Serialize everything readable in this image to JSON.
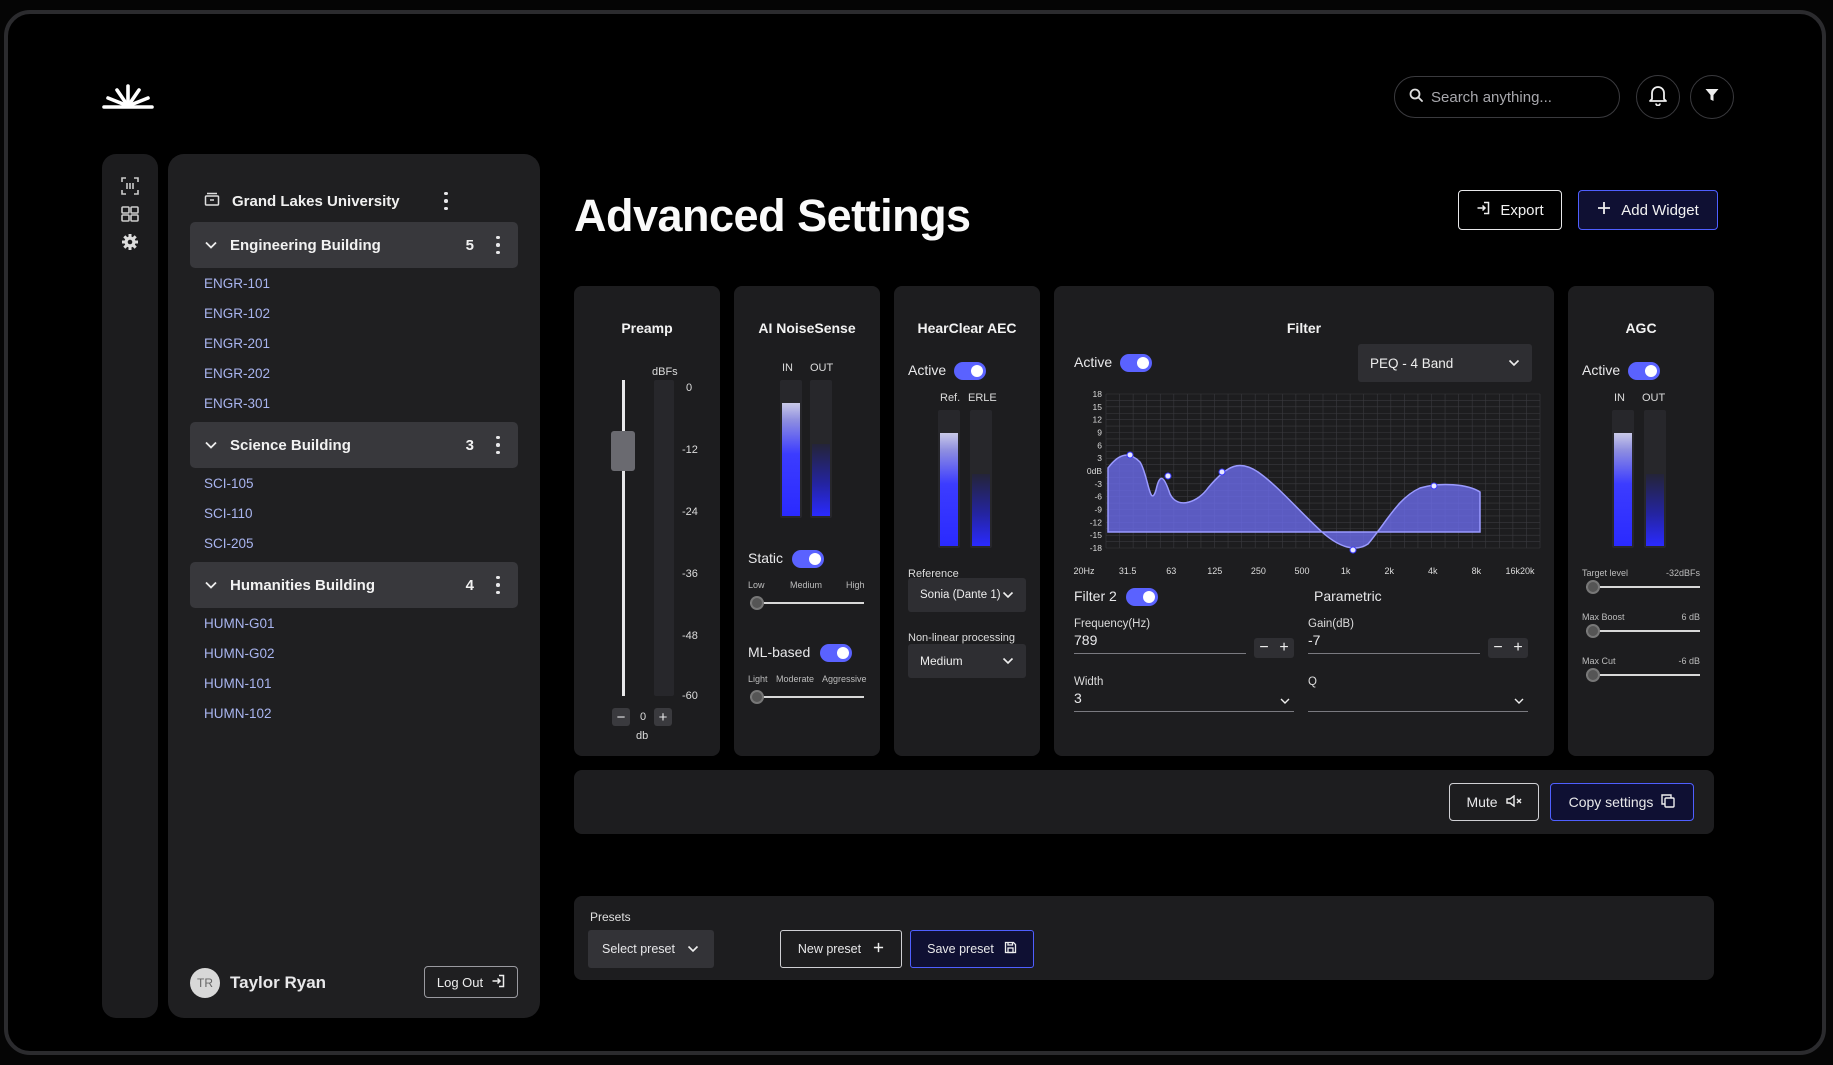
{
  "header": {
    "search_placeholder": "Search anything...",
    "icons": [
      "logo-icon",
      "search-icon",
      "bell-icon",
      "filter-icon"
    ]
  },
  "rail": {
    "icons": [
      "scan-icon",
      "grid-icon",
      "gear-icon"
    ]
  },
  "sidebar": {
    "org": "Grand Lakes University",
    "groups": [
      {
        "label": "Engineering Building",
        "count": "5",
        "rooms": [
          "ENGR-101",
          "ENGR-102",
          "ENGR-201",
          "ENGR-202",
          "ENGR-301"
        ]
      },
      {
        "label": "Science Building",
        "count": "3",
        "rooms": [
          "SCI-105",
          "SCI-110",
          "SCI-205"
        ]
      },
      {
        "label": "Humanities Building",
        "count": "4",
        "rooms": [
          "HUMN-G01",
          "HUMN-G02",
          "HUMN-101",
          "HUMN-102"
        ]
      }
    ],
    "user": {
      "initials": "TR",
      "name": "Taylor Ryan"
    },
    "logout": "Log Out"
  },
  "page": {
    "title": "Advanced Settings",
    "export": "Export",
    "add_widget": "Add Widget"
  },
  "preamp": {
    "title": "Preamp",
    "unit": "dBFs",
    "scale": [
      "0",
      "-12",
      "-24",
      "-36",
      "-48",
      "-60"
    ],
    "value": "0",
    "value_unit": "db",
    "fader_level": 0.84
  },
  "noise": {
    "title": "AI NoiseSense",
    "in": "IN",
    "out": "OUT",
    "in_level": 0.85,
    "out_level": 0.55,
    "static_label": "Static",
    "static_on": true,
    "static_scale": [
      "Low",
      "Medium",
      "High"
    ],
    "static_level": 0,
    "ml_label": "ML-based",
    "ml_on": true,
    "ml_scale": [
      "Light",
      "Moderate",
      "Aggressive"
    ],
    "ml_level": 0
  },
  "aec": {
    "title": "HearClear AEC",
    "active": "Active",
    "active_on": true,
    "ref": "Ref.",
    "erle": "ERLE",
    "ref_level": 0.85,
    "erle_level": 0.55,
    "reference_label": "Reference",
    "reference_value": "Sonia (Dante 1)",
    "nlp_label": "Non-linear processing",
    "nlp_value": "Medium"
  },
  "filter": {
    "title": "Filter",
    "active": "Active",
    "active_on": true,
    "preset": "PEQ - 4 Band",
    "y_ticks": [
      "18",
      "15",
      "12",
      "9",
      "6",
      "3",
      "0dB",
      "-3",
      "-6",
      "-9",
      "-12",
      "-15",
      "-18"
    ],
    "x_ticks": [
      "20Hz",
      "31.5",
      "63",
      "125",
      "250",
      "500",
      "1k",
      "2k",
      "4k",
      "8k",
      "16k20k"
    ],
    "filter2_label": "Filter 2",
    "filter2_on": true,
    "type": "Parametric",
    "freq_label": "Frequency(Hz)",
    "freq_value": "789",
    "gain_label": "Gain(dB)",
    "gain_value": "-7",
    "width_label": "Width",
    "width_value": "3",
    "q_label": "Q",
    "q_value": ""
  },
  "agc": {
    "title": "AGC",
    "active": "Active",
    "active_on": true,
    "in": "IN",
    "out": "OUT",
    "in_level": 0.85,
    "out_level": 0.55,
    "target_label": "Target level",
    "target_value": "-32dBFs",
    "target_level": 0,
    "boost_label": "Max Boost",
    "boost_value": "6 dB",
    "boost_level": 0,
    "cut_label": "Max Cut",
    "cut_value": "-6 dB",
    "cut_level": 0
  },
  "actions": {
    "mute": "Mute",
    "copy": "Copy settings"
  },
  "presets": {
    "label": "Presets",
    "select": "Select preset",
    "new": "New preset",
    "save": "Save preset"
  },
  "colors": {
    "accent": "#4f5fff",
    "room_link": "#a9b5f0",
    "meter": "#2a2aff"
  }
}
